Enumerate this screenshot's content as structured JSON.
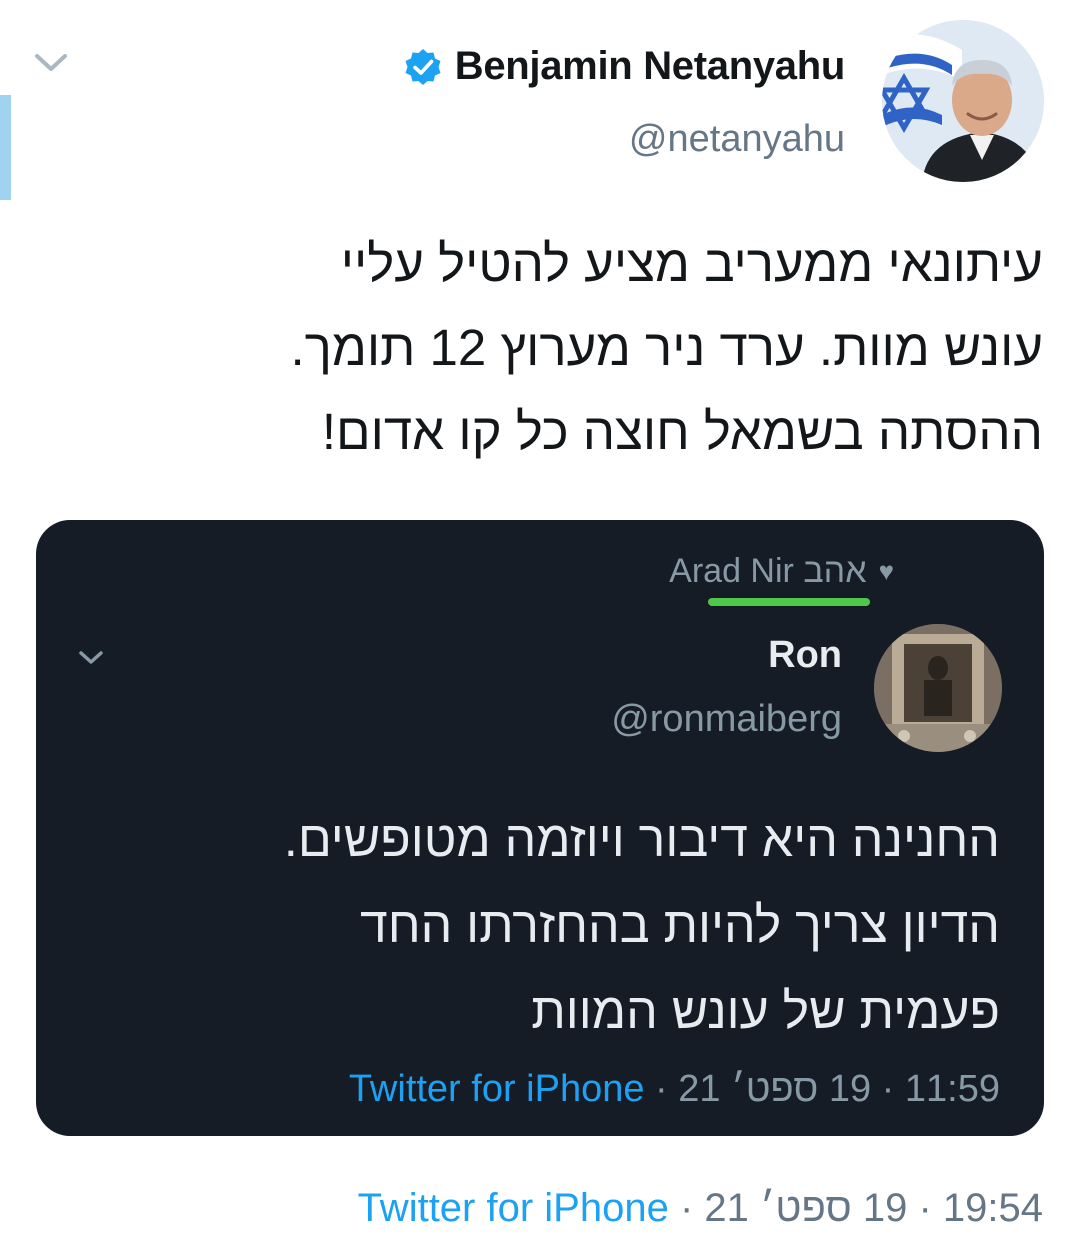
{
  "tweet": {
    "author_name": "Benjamin Netanyahu",
    "handle": "@netanyahu",
    "text_lines": [
      "עיתונאי ממעריב מציע להטיל עליי",
      "עונש מוות. ערד ניר מערוץ 12 תומך.",
      "ההסתה בשמאל חוצה כל קו אדום!"
    ],
    "footer": {
      "source": "Twitter for iPhone",
      "separator": " · ",
      "date": "19 ספט׳ 21",
      "time": "19:54"
    }
  },
  "embedded_tweet": {
    "liked_by": "Arad Nir אהב",
    "author_name": "Ron",
    "handle": "@ronmaiberg",
    "text_lines": [
      "החנינה היא דיבור ויוזמה מטופשים.",
      "הדיון צריך להיות בהחזרתו החד",
      "פעמית של עונש המוות"
    ],
    "footer": {
      "source": "Twitter for iPhone",
      "separator": " · ",
      "date": "19 ספט׳ 21",
      "time": "11:59"
    }
  },
  "icons": {
    "verified": "verified-badge-icon",
    "heart": "heart-icon",
    "chevron": "chevron-down-icon"
  },
  "colors": {
    "link_blue": "#1da1f2",
    "embed_background": "#151c26",
    "highlight_green": "#4ec74a",
    "verified_blue": "#1da1f2"
  }
}
